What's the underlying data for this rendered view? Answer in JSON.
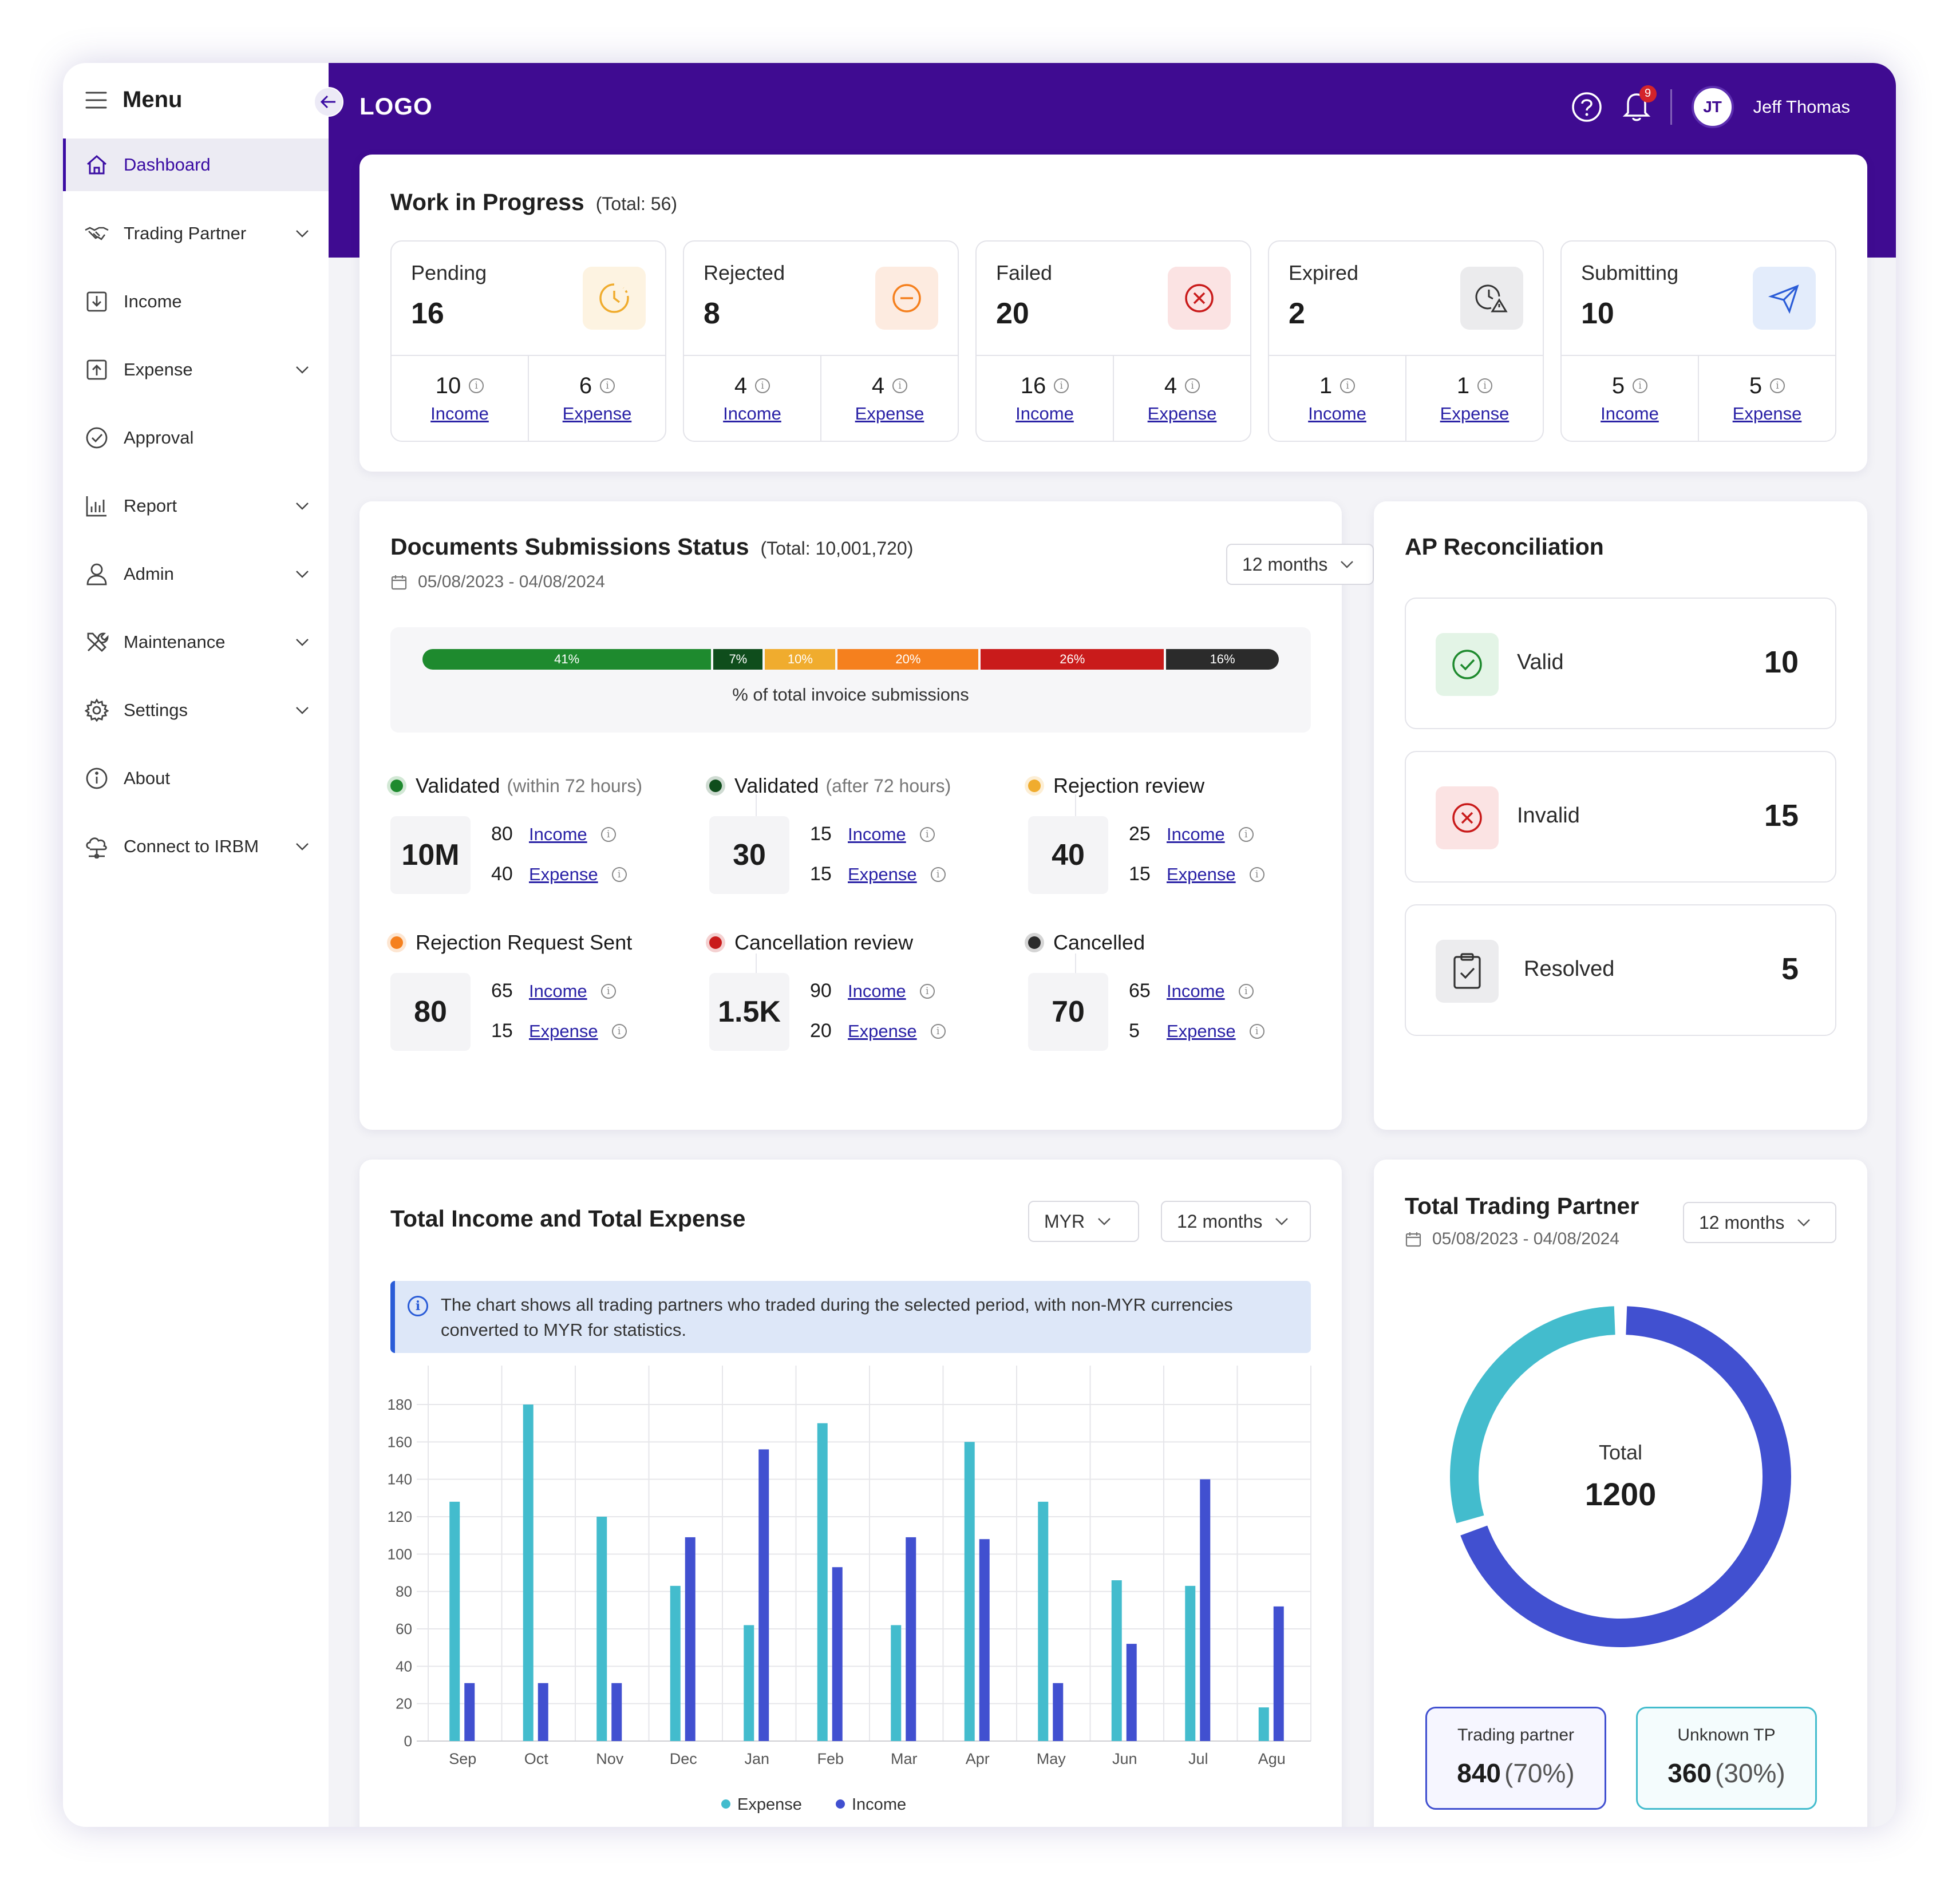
{
  "sidebar": {
    "title": "Menu",
    "items": [
      {
        "label": "Dashboard"
      },
      {
        "label": "Trading Partner"
      },
      {
        "label": "Income"
      },
      {
        "label": "Expense"
      },
      {
        "label": "Approval"
      },
      {
        "label": "Report"
      },
      {
        "label": "Admin"
      },
      {
        "label": "Maintenance"
      },
      {
        "label": "Settings"
      },
      {
        "label": "About"
      },
      {
        "label": "Connect to IRBM"
      }
    ]
  },
  "header": {
    "logo": "LOGO",
    "notifications": "9",
    "user_initials": "JT",
    "user_name": "Jeff Thomas"
  },
  "wip": {
    "title": "Work in Progress",
    "total": "(Total: 56)",
    "cards": [
      {
        "label": "Pending",
        "value": "16",
        "income": "10",
        "expense": "6"
      },
      {
        "label": "Rejected",
        "value": "8",
        "income": "4",
        "expense": "4"
      },
      {
        "label": "Failed",
        "value": "20",
        "income": "16",
        "expense": "4"
      },
      {
        "label": "Expired",
        "value": "2",
        "income": "1",
        "expense": "1"
      },
      {
        "label": "Submitting",
        "value": "10",
        "income": "5",
        "expense": "5"
      }
    ],
    "income_label": "Income",
    "expense_label": "Expense"
  },
  "docs": {
    "title": "Documents Submissions Status",
    "total": "(Total: 10,001,720)",
    "date_range": "05/08/2023 - 04/08/2024",
    "period": "12 months",
    "bar": [
      {
        "pct": "41%",
        "value": 41,
        "color": "#1e8a2e"
      },
      {
        "pct": "7%",
        "value": 7,
        "color": "#0f4d1c"
      },
      {
        "pct": "10%",
        "value": 10,
        "color": "#f0ac2e"
      },
      {
        "pct": "20%",
        "value": 20,
        "color": "#f5801e"
      },
      {
        "pct": "26%",
        "value": 26,
        "color": "#c91b1b"
      },
      {
        "pct": "16%",
        "value": 16,
        "color": "#2b2b2b"
      }
    ],
    "bar_caption": "% of total invoice submissions",
    "stats": [
      {
        "label": "Validated",
        "note": "(within 72 hours)",
        "big": "10M",
        "income": "80",
        "expense": "40",
        "color": "#1e8a2e"
      },
      {
        "label": "Validated",
        "note": "(after 72 hours)",
        "big": "30",
        "income": "15",
        "expense": "15",
        "color": "#0f4d1c"
      },
      {
        "label": "Rejection review",
        "note": "",
        "big": "40",
        "income": "25",
        "expense": "15",
        "color": "#f0ac2e"
      },
      {
        "label": "Rejection Request Sent",
        "note": "",
        "big": "80",
        "income": "65",
        "expense": "15",
        "color": "#f5801e"
      },
      {
        "label": "Cancellation review",
        "note": "",
        "big": "1.5K",
        "income": "90",
        "expense": "20",
        "color": "#c91b1b"
      },
      {
        "label": "Cancelled",
        "note": "",
        "big": "70",
        "income": "65",
        "expense": "5",
        "color": "#2b2b2b"
      }
    ]
  },
  "ap": {
    "title": "AP Reconciliation",
    "items": [
      {
        "label": "Valid",
        "value": "10"
      },
      {
        "label": "Invalid",
        "value": "15"
      },
      {
        "label": "Resolved",
        "value": "5"
      }
    ]
  },
  "income_chart": {
    "title": "Total Income and Total Expense",
    "currency": "MYR",
    "period": "12 months",
    "notice": "The chart shows all trading partners who traded during the selected period, with non-MYR currencies converted to MYR for statistics.",
    "legend_expense": "Expense",
    "legend_income": "Income"
  },
  "tp": {
    "title": "Total Trading Partner",
    "date_range": "05/08/2023 - 04/08/2024",
    "period": "12 months",
    "center_label": "Total",
    "center_value": "1200",
    "partner_label": "Trading partner",
    "partner_value": "840",
    "partner_pct": "(70%)",
    "unknown_label": "Unknown TP",
    "unknown_value": "360",
    "unknown_pct": "(30%)"
  },
  "chart_data": [
    {
      "type": "bar",
      "categories": [
        "Sep",
        "Oct",
        "Nov",
        "Dec",
        "Jan",
        "Feb",
        "Mar",
        "Apr",
        "May",
        "Jun",
        "Jul",
        "Agu"
      ],
      "series": [
        {
          "name": "Expense",
          "color": "#43bccd",
          "values": [
            128,
            180,
            120,
            83,
            62,
            170,
            62,
            160,
            128,
            86,
            83,
            18
          ]
        },
        {
          "name": "Income",
          "color": "#4150d0",
          "values": [
            31,
            31,
            31,
            109,
            156,
            93,
            109,
            108,
            31,
            52,
            140,
            72
          ]
        }
      ],
      "ylim": [
        0,
        180
      ],
      "yticks": [
        0,
        20,
        40,
        60,
        80,
        100,
        120,
        140,
        160,
        180
      ],
      "grid": true,
      "legend": "bottom"
    },
    {
      "type": "pie",
      "categories": [
        "Trading partner",
        "Unknown TP"
      ],
      "values": [
        840,
        360
      ],
      "colors": [
        "#4150d0",
        "#43bccd"
      ],
      "legend": "bottom"
    }
  ]
}
